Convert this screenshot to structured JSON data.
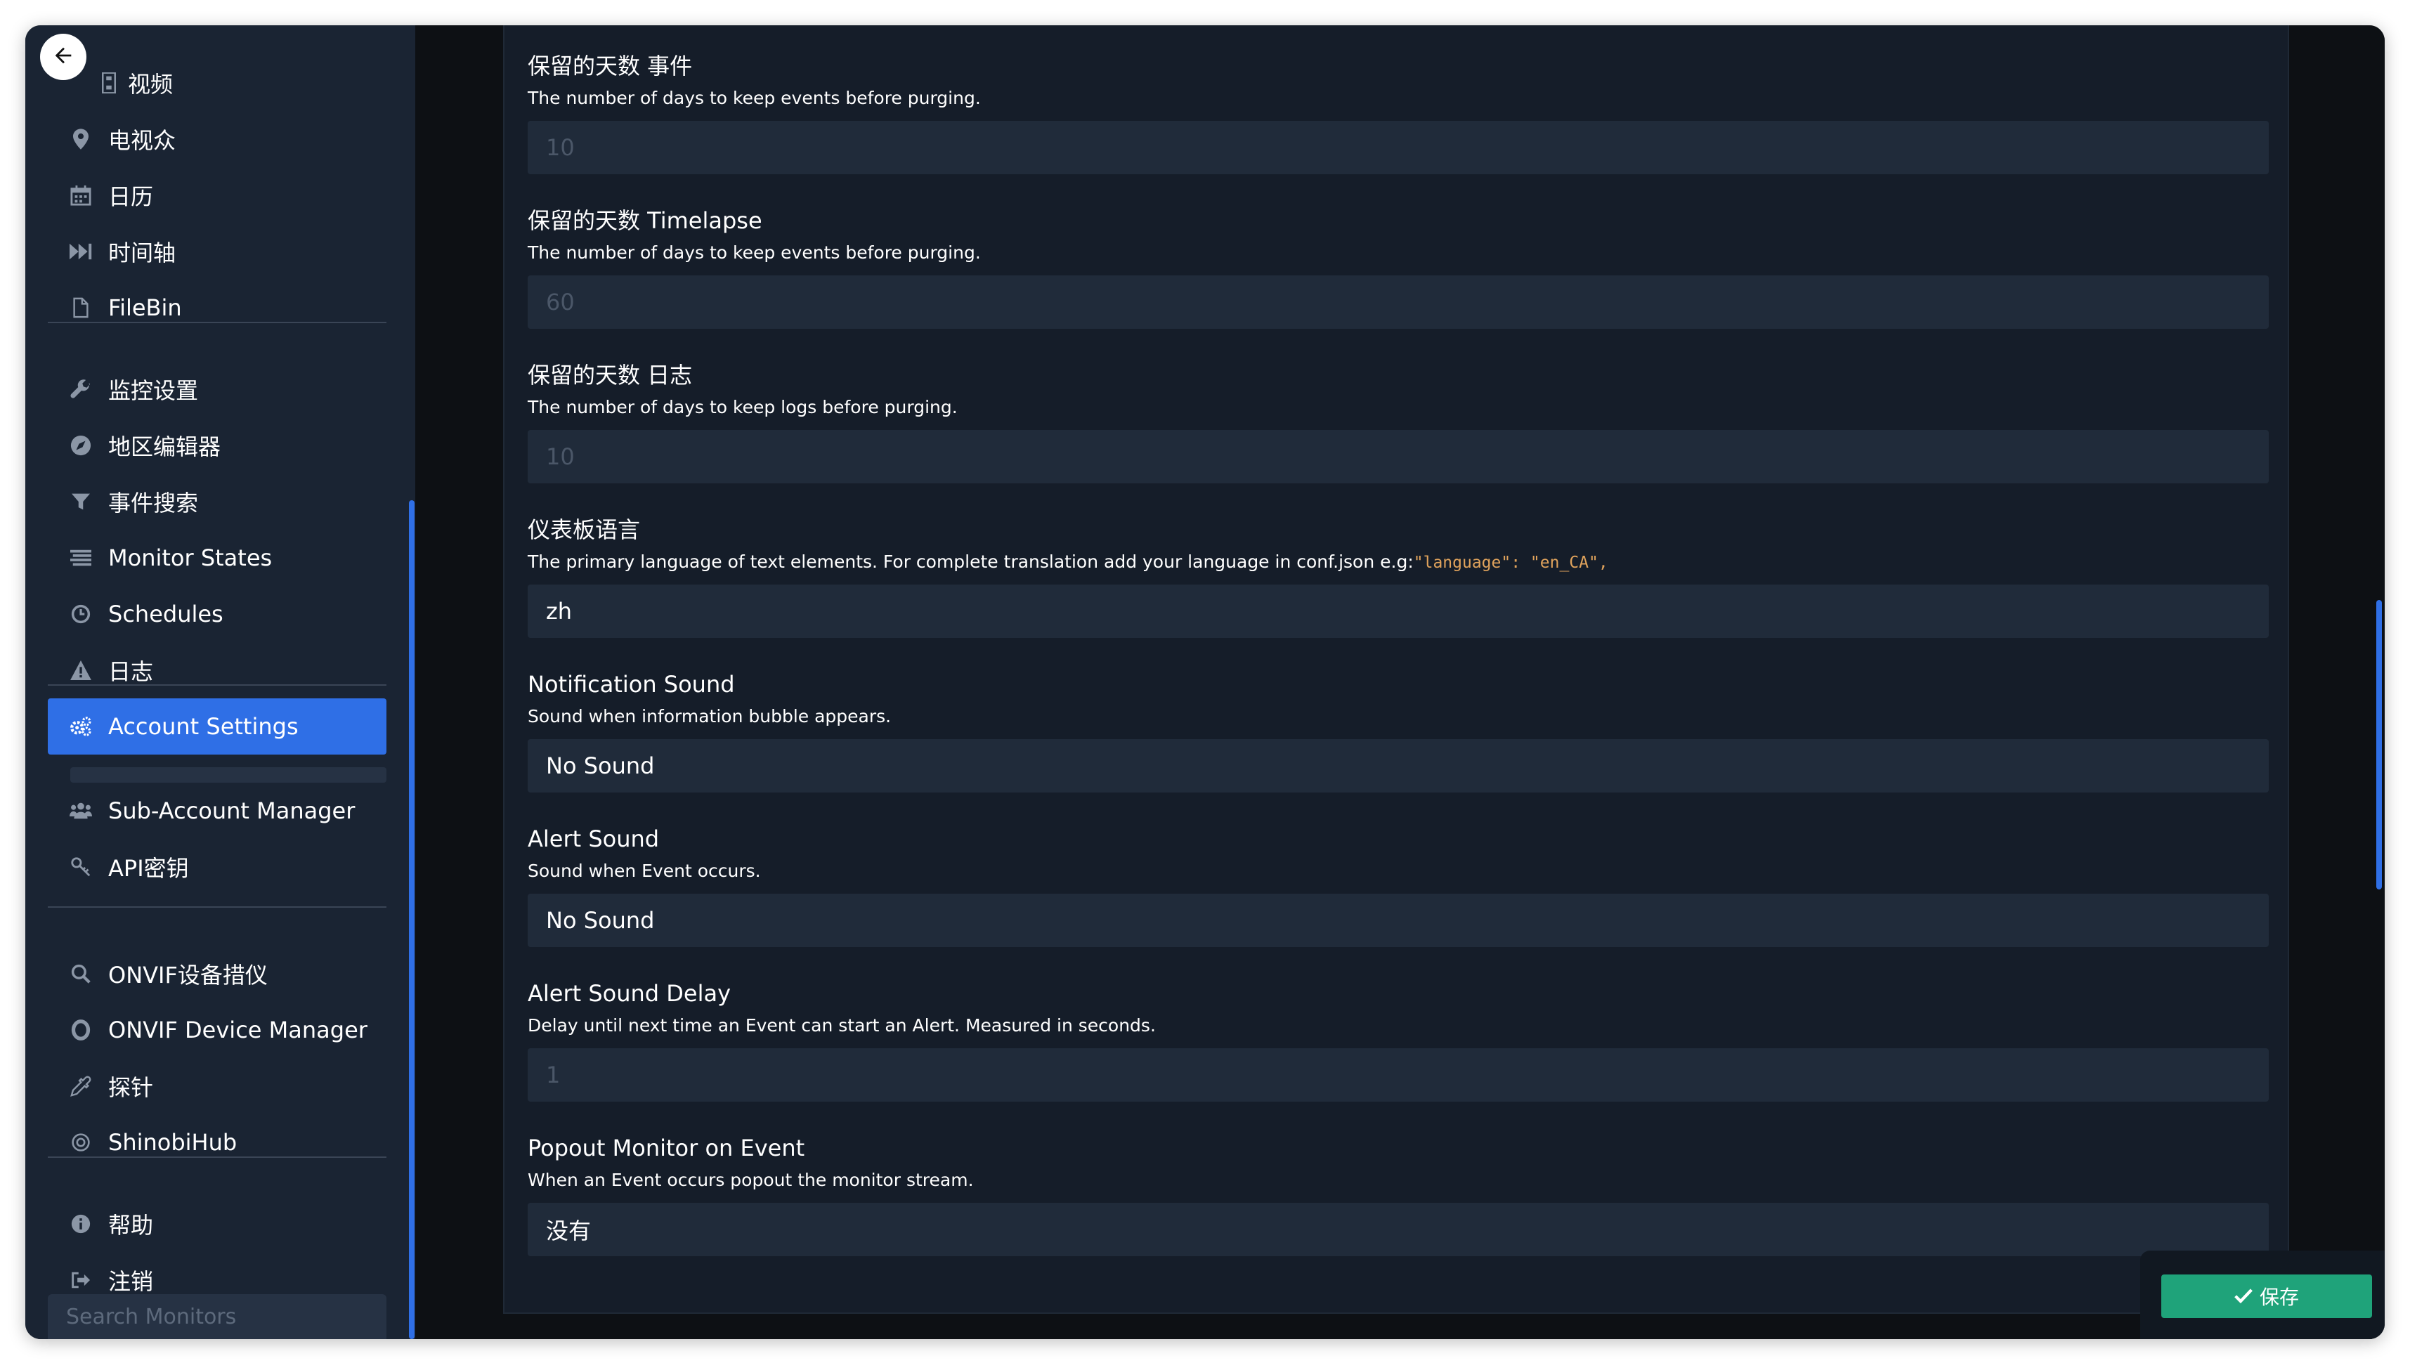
{
  "sidebar": {
    "groups": [
      {
        "items": [
          {
            "icon": "video-icon",
            "label": "视频"
          },
          {
            "icon": "map-marker-icon",
            "label": "电视众"
          },
          {
            "icon": "calendar-icon",
            "label": "日历"
          },
          {
            "icon": "fast-forward-icon",
            "label": "时间轴"
          },
          {
            "icon": "file-icon",
            "label": "FileBin"
          }
        ]
      },
      {
        "items": [
          {
            "icon": "wrench-icon",
            "label": "监控设置"
          },
          {
            "icon": "compass-icon",
            "label": "地区编辑器"
          },
          {
            "icon": "filter-icon",
            "label": "事件搜索"
          },
          {
            "icon": "list-icon",
            "label": "Monitor States"
          },
          {
            "icon": "clock-icon",
            "label": "Schedules"
          },
          {
            "icon": "warning-icon",
            "label": "日志"
          }
        ]
      },
      {
        "items": [
          {
            "icon": "cogs-icon",
            "label": "Account Settings",
            "active": true
          },
          {
            "icon": "users-icon",
            "label": "Sub-Account Manager"
          },
          {
            "icon": "key-icon",
            "label": "API密钥"
          }
        ]
      },
      {
        "items": [
          {
            "icon": "search-icon",
            "label": "ONVIF设备措仪"
          },
          {
            "icon": "circle-o-icon",
            "label": "ONVIF Device Manager"
          },
          {
            "icon": "eyedropper-icon",
            "label": "探针"
          },
          {
            "icon": "hub-icon",
            "label": "ShinobiHub"
          }
        ]
      },
      {
        "items": [
          {
            "icon": "info-icon",
            "label": "帮助"
          },
          {
            "icon": "sign-out-icon",
            "label": "注销"
          }
        ]
      }
    ],
    "search_placeholder": "Search Monitors"
  },
  "settings": {
    "fields": [
      {
        "label": "保留的天数 事件",
        "desc": "The number of days to keep events before purging.",
        "placeholder": "10"
      },
      {
        "label": "保留的天数 Timelapse",
        "desc": "The number of days to keep events before purging.",
        "placeholder": "60"
      },
      {
        "label": "保留的天数 日志",
        "desc": "The number of days to keep logs before purging.",
        "placeholder": "10"
      },
      {
        "label": "仪表板语言",
        "desc": "The primary language of text elements. For complete translation add your language in conf.json e.g:",
        "desc_code": "\"language\": \"en_CA\",",
        "value": "zh"
      },
      {
        "label": "Notification Sound",
        "desc": "Sound when information bubble appears.",
        "value": "No Sound"
      },
      {
        "label": "Alert Sound",
        "desc": "Sound when Event occurs.",
        "value": "No Sound"
      },
      {
        "label": "Alert Sound Delay",
        "desc": "Delay until next time an Event can start an Alert. Measured in seconds.",
        "placeholder": "1"
      },
      {
        "label": "Popout Monitor on Event",
        "desc": "When an Event occurs popout the monitor stream.",
        "value": "没有"
      }
    ]
  },
  "save_button": {
    "label": "保存"
  },
  "colors": {
    "accent": "#2f6fe6",
    "save": "#1fa37a",
    "sidebar": "#1a2433",
    "panel": "#151d29",
    "input": "#202b3a"
  }
}
